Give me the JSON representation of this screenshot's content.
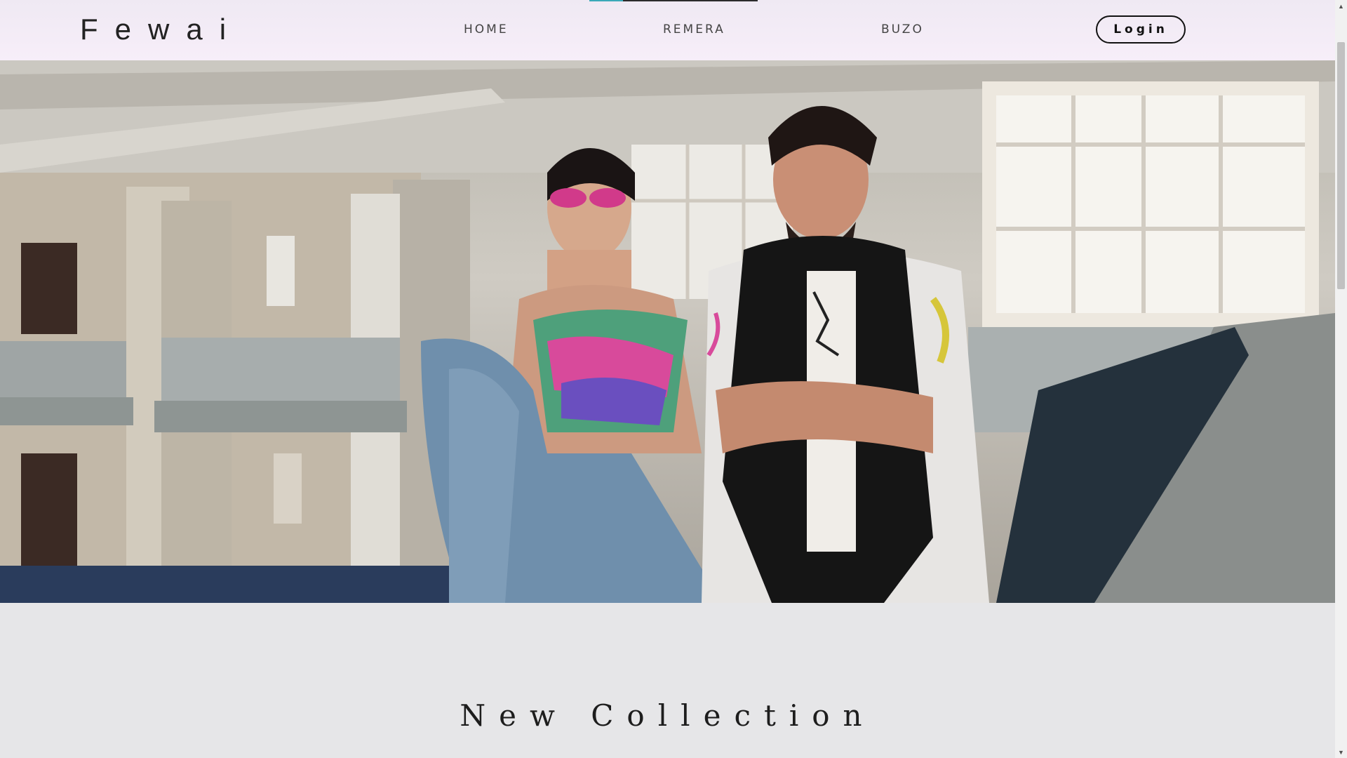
{
  "brand": {
    "name": "Fewai"
  },
  "nav": {
    "items": [
      {
        "label": "HOME"
      },
      {
        "label": "REMERA"
      },
      {
        "label": "BUZO"
      }
    ],
    "login_label": "Login"
  },
  "hero": {
    "image_subject": "two-people-fashion-photo"
  },
  "section": {
    "title": "New Collection"
  },
  "colors": {
    "navbar_bg": "#f5edf8",
    "accent": "#3aa9b8",
    "page_bg": "#e6e6e8",
    "text": "#222222"
  },
  "icons": {
    "scroll_up": "chevron-up-icon",
    "scroll_down": "chevron-down-icon"
  }
}
